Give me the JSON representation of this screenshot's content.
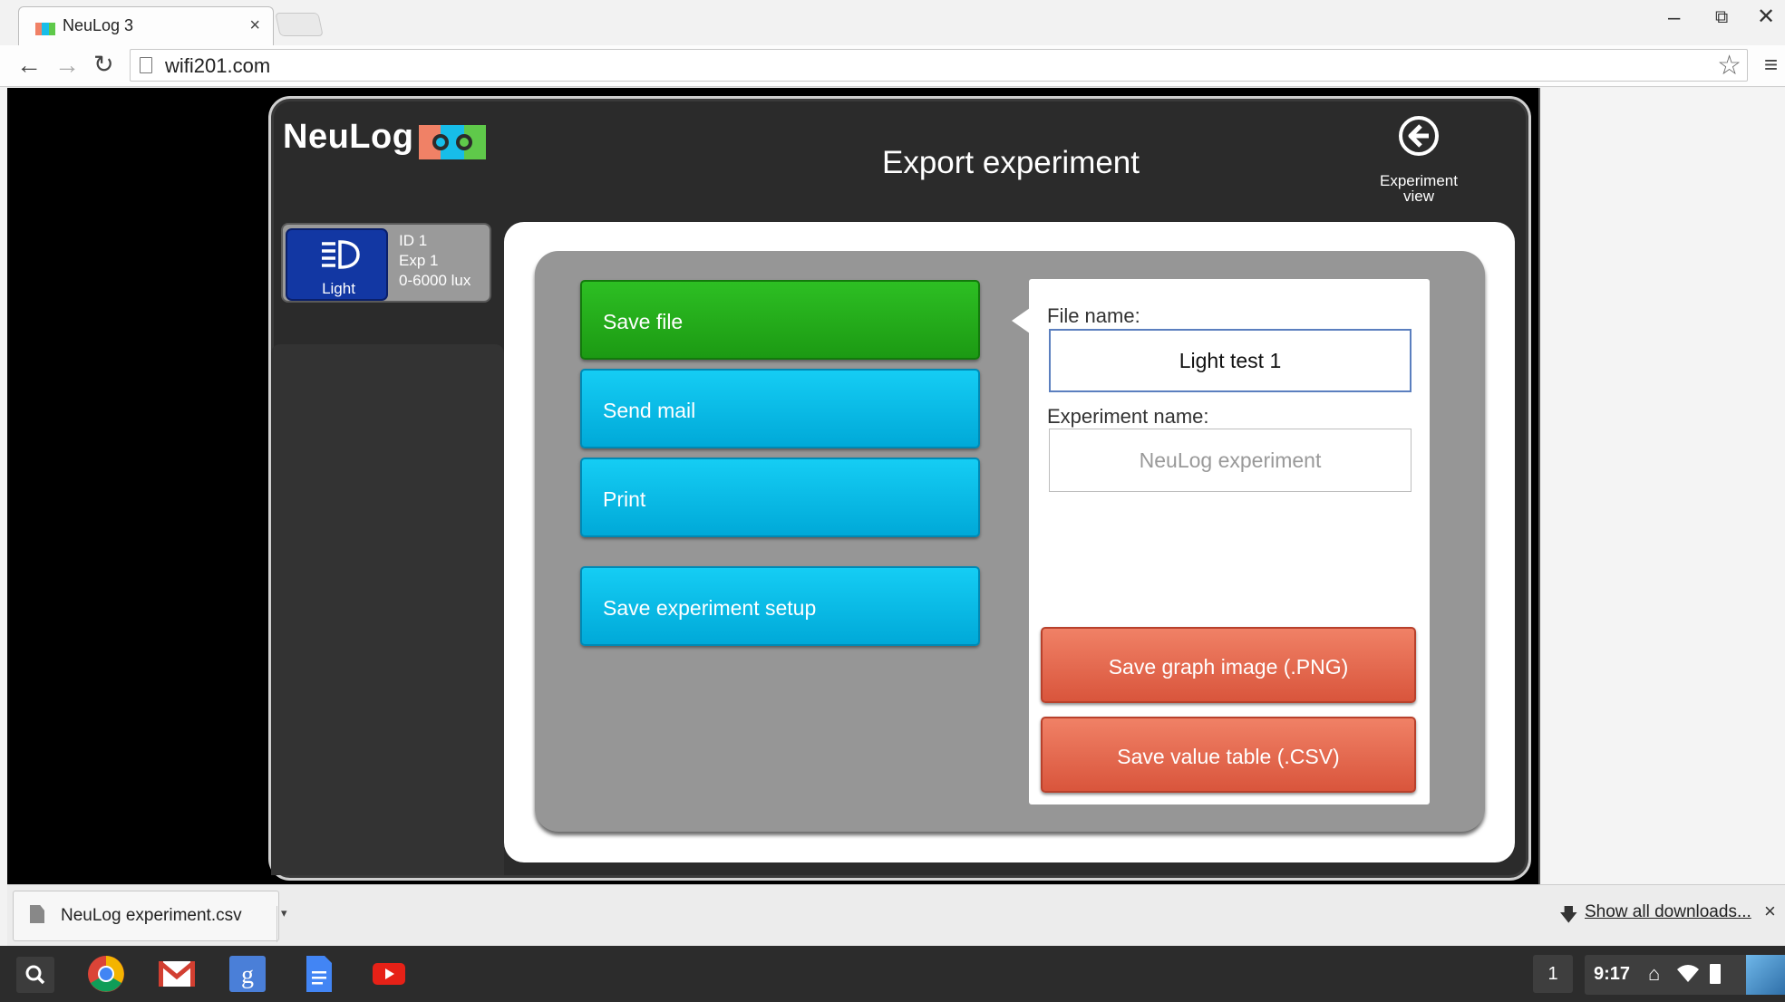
{
  "browser": {
    "tab_title": "NeuLog 3",
    "tab_close": "×",
    "url": "wifi201.com",
    "icons": {
      "back": "back-arrow-icon",
      "forward": "forward-arrow-icon",
      "reload": "reload-icon",
      "bookmark": "star-icon",
      "menu": "hamburger-menu-icon"
    }
  },
  "app": {
    "logo_text": "NeuLog",
    "title": "Export experiment",
    "experiment_view_label_line1": "Experiment",
    "experiment_view_label_line2": "view"
  },
  "sensor": {
    "name": "Light",
    "id": "ID 1",
    "exp": "Exp 1",
    "range": "0-6000 lux",
    "color": "#1237a3"
  },
  "menu": {
    "save_file": "Save file",
    "send_mail": "Send mail",
    "print": "Print",
    "save_setup": "Save experiment setup",
    "active": "save_file"
  },
  "form": {
    "file_name_label": "File name:",
    "file_name_value": "Light test 1",
    "experiment_name_label": "Experiment name:",
    "experiment_name_placeholder": "NeuLog experiment",
    "save_png": "Save graph image (.PNG)",
    "save_csv": "Save value table (.CSV)"
  },
  "downloads": {
    "file_name": "NeuLog experiment.csv",
    "show_all": "Show all downloads...",
    "close": "×"
  },
  "shelf": {
    "apps": [
      "chrome-icon",
      "gmail-icon",
      "google-search-icon",
      "docs-icon",
      "youtube-icon"
    ],
    "notification_count": "1",
    "time": "9:17"
  },
  "colors": {
    "green_button": "#1fa516",
    "cyan_button": "#0ab8e6",
    "orange_button": "#e6664b"
  }
}
